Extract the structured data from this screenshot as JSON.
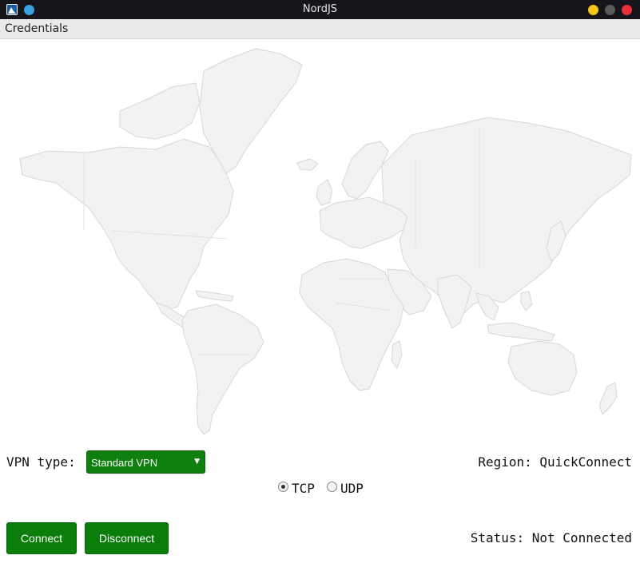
{
  "window": {
    "title": "NordJS",
    "app_icon": "app-logo-icon",
    "pin_icon": "pin-icon",
    "controls": [
      "minimize-button",
      "maximize-button",
      "close-button"
    ],
    "control_colors": {
      "minimize": "#f5c518",
      "maximize": "#5a5a5a",
      "close": "#e8303a"
    }
  },
  "menubar": {
    "items": [
      {
        "label": "Credentials"
      }
    ]
  },
  "map": {
    "type": "world-map",
    "land_color": "#f2f2f2",
    "border_color": "#d6d6d6"
  },
  "controls": {
    "vpn_type_label": "VPN type:",
    "vpn_type_selected": "Standard VPN",
    "region_text": "Region: QuickConnect",
    "protocol": {
      "options": [
        {
          "label": "TCP",
          "selected": true
        },
        {
          "label": "UDP",
          "selected": false
        }
      ]
    },
    "connect_label": "Connect",
    "disconnect_label": "Disconnect",
    "status_text": "Status: Not Connected",
    "accent_color": "#0a7d0a"
  }
}
